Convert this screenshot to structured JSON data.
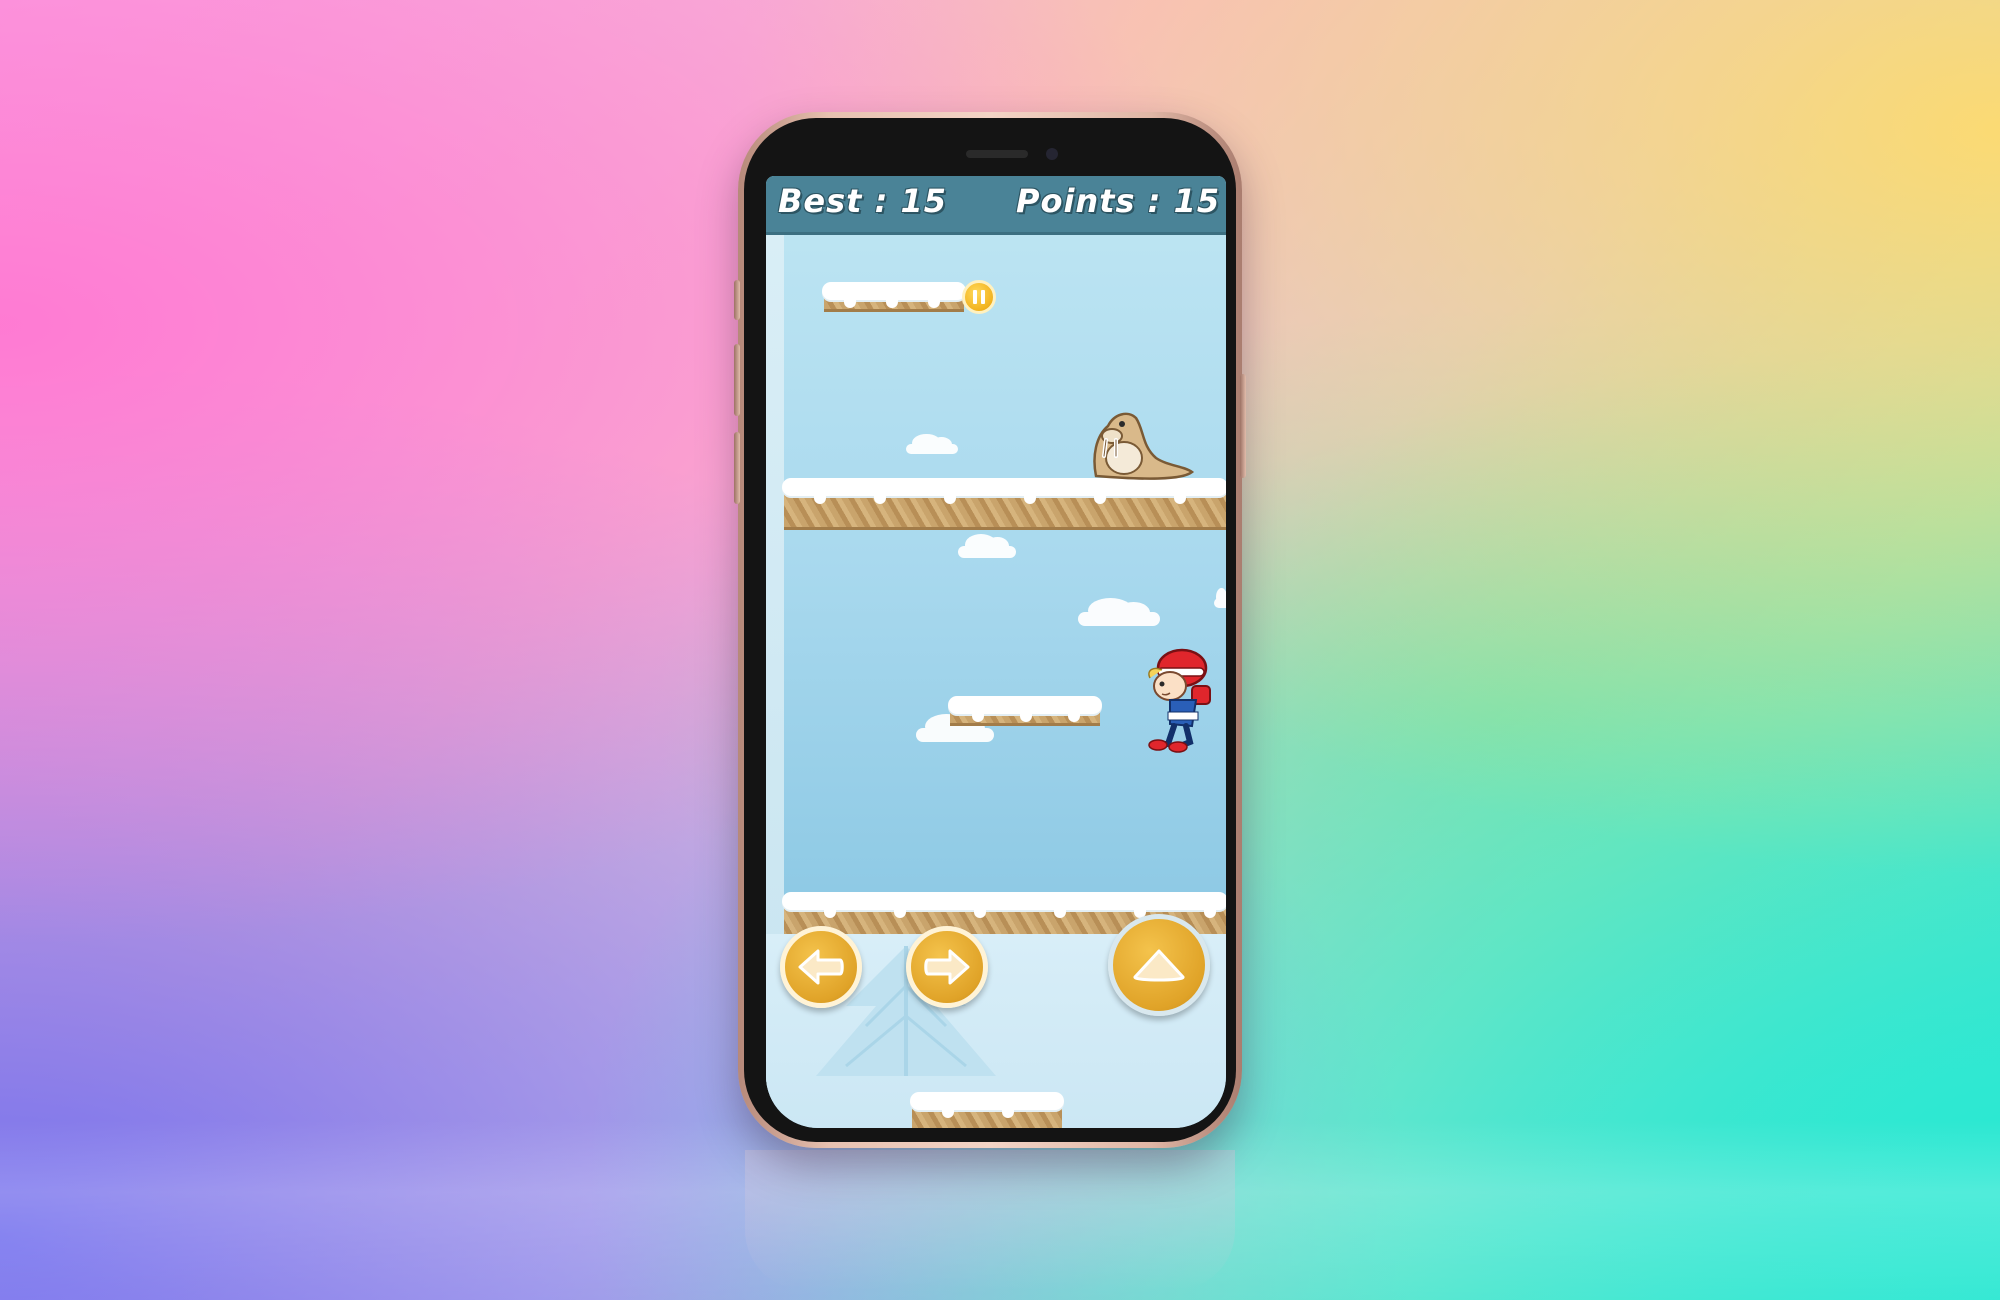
{
  "hud": {
    "best_label": "Best : 15",
    "points_label": "Points : 15"
  },
  "colors": {
    "hud_bar": "#4a8397",
    "sky": "#a9d9ee",
    "button_gold": "#e0a328",
    "platform_dirt": "#c9a46c",
    "snow": "#ffffff"
  },
  "controls": {
    "left_icon": "arrow-left-icon",
    "right_icon": "arrow-right-icon",
    "jump_icon": "arrow-up-icon",
    "pause_icon": "pause-icon"
  },
  "characters": {
    "enemy": "walrus",
    "player": "girl-in-red-hat"
  }
}
